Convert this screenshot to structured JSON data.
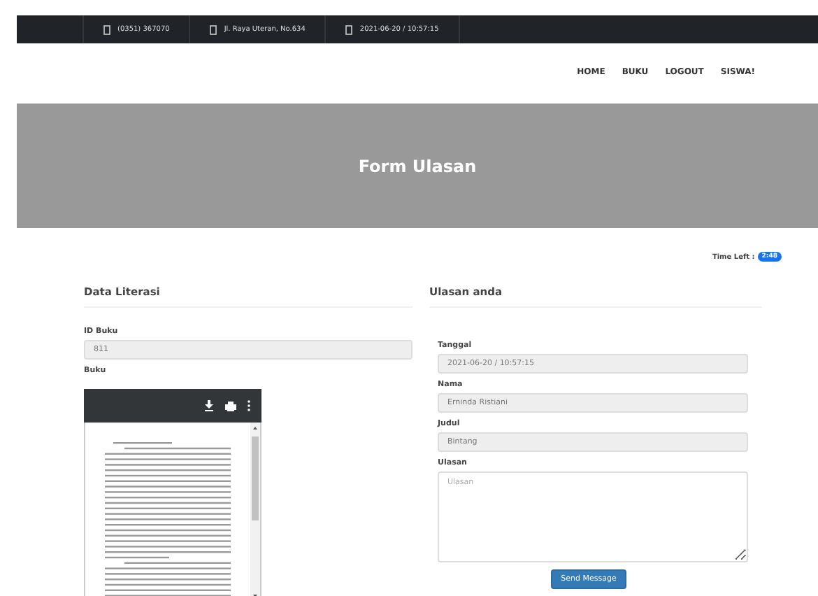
{
  "topbar": {
    "items": [
      {
        "text": "(0351) 367070"
      },
      {
        "text": "Jl. Raya Uteran, No.634"
      },
      {
        "text": "2021-06-20 / 10:57:15"
      }
    ]
  },
  "nav": {
    "items": [
      "HOME",
      "BUKU",
      "LOGOUT",
      "SISWA!"
    ]
  },
  "banner": {
    "title": "Form Ulasan"
  },
  "left": {
    "title": "Data Literasi",
    "fields": [
      {
        "label": "ID Buku",
        "value": "811"
      }
    ],
    "viewer_label": "Buku"
  },
  "right": {
    "timer": {
      "label": "Time Left :",
      "value": "2:48"
    },
    "title": "Ulasan anda",
    "fields": [
      {
        "label": "Tanggal",
        "value": "2021-06-20 / 10:57:15"
      },
      {
        "label": "Nama",
        "value": "Erninda Ristiani"
      },
      {
        "label": "Judul",
        "value": "Bintang"
      }
    ],
    "review": {
      "label": "Ulasan",
      "placeholder": "Ulasan"
    },
    "button": "Send Message"
  }
}
